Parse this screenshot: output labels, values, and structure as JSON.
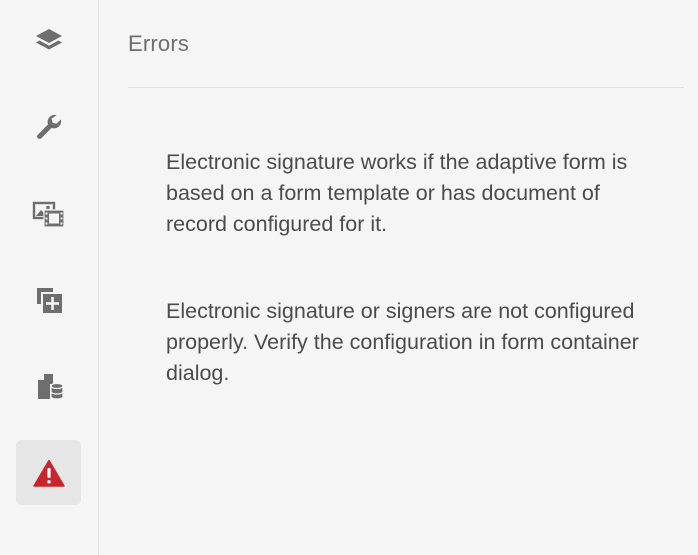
{
  "sidebar": {
    "items": [
      {
        "icon": "layers-icon"
      },
      {
        "icon": "wrench-icon"
      },
      {
        "icon": "media-icon"
      },
      {
        "icon": "add-component-icon"
      },
      {
        "icon": "data-sources-icon"
      },
      {
        "icon": "error-warning-icon"
      }
    ],
    "active_index": 5
  },
  "panel": {
    "title": "Errors",
    "messages": [
      "Electronic signature works if the adaptive form is based on a form template or has document of record configured for it.",
      "Electronic signature or signers are not configured properly. Verify the configuration in form container dialog."
    ]
  },
  "colors": {
    "icon": "#6e6e6e",
    "error": "#c9252d",
    "active_bg": "#e6e6e6"
  }
}
